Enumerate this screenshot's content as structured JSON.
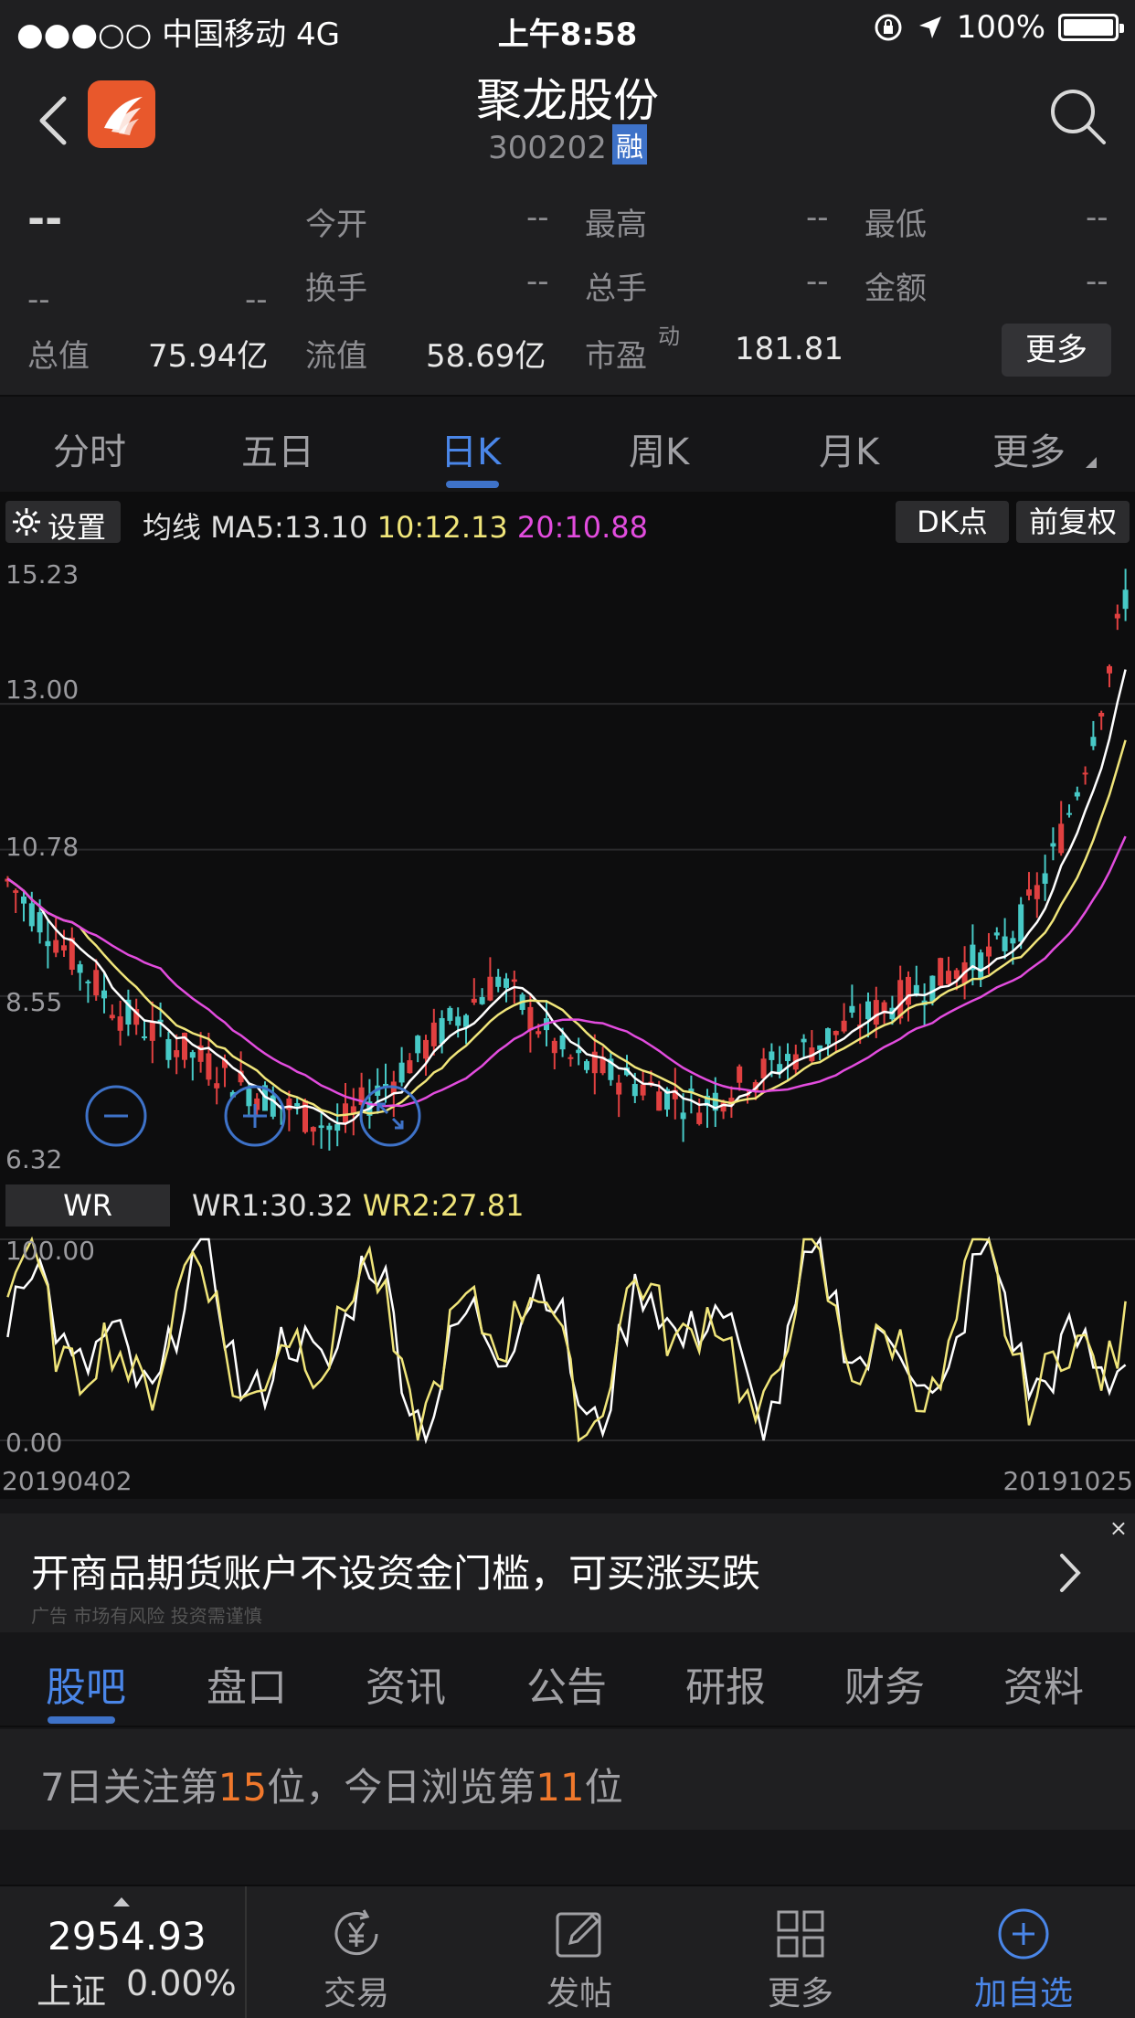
{
  "status_bar": {
    "carrier": "●●●○○ 中国移动   4G",
    "time": "上午8:58",
    "battery": "100%"
  },
  "header": {
    "stock_name": "聚龙股份",
    "stock_code": "300202",
    "badge": "融"
  },
  "quote": {
    "price": "--",
    "change": "--",
    "change_pct": "--",
    "rows": [
      {
        "label": "今开",
        "value": "--"
      },
      {
        "label": "最高",
        "value": "--"
      },
      {
        "label": "最低",
        "value": "--"
      },
      {
        "label": "换手",
        "value": "--"
      },
      {
        "label": "总手",
        "value": "--"
      },
      {
        "label": "金额",
        "value": "--"
      }
    ],
    "total_cap_label": "总值",
    "total_cap": "75.94亿",
    "float_cap_label": "流值",
    "float_cap": "58.69亿",
    "pe_label": "市盈",
    "pe_sup": "动",
    "pe": "181.81",
    "more_button": "更多"
  },
  "period_tabs": [
    "分时",
    "五日",
    "日K",
    "周K",
    "月K",
    "更多"
  ],
  "active_period": "日K",
  "chart_toolbar": {
    "settings": "设置",
    "ma_label": "均线",
    "ma5": "MA5:13.10",
    "ma10": "10:12.13",
    "ma20": "20:10.88",
    "dk_button": "DK点",
    "fq_button": "前复权"
  },
  "price_axis": [
    "15.23",
    "13.00",
    "10.78",
    "8.55",
    "6.32"
  ],
  "wr_toolbar": {
    "button": "WR",
    "wr1": "WR1:30.32",
    "wr2": "WR2:27.81"
  },
  "wr_axis": [
    "100.00",
    "0.00"
  ],
  "date_axis": {
    "start": "20190402",
    "end": "20191025"
  },
  "colors": {
    "up": "#e04040",
    "down": "#47c9c6",
    "ma5": "#ffffff",
    "ma10": "#f0e57a",
    "ma20": "#e24cde",
    "wr1": "#ffffff",
    "wr2": "#f0e57a",
    "accent": "#4a86e8",
    "highlight": "#f0782c"
  },
  "ad": {
    "text": "开商品期货账户不设资金门槛，可买涨买跌",
    "sub": "广告 市场有风险 投资需谨慎",
    "close": "×"
  },
  "info_tabs": [
    "股吧",
    "盘口",
    "资讯",
    "公告",
    "研报",
    "财务",
    "资料"
  ],
  "active_info_tab": "股吧",
  "rank": {
    "p1": "7日关注第",
    "n1": "15",
    "p2": "位，今日浏览第",
    "n2": "11",
    "p3": "位"
  },
  "bottom": {
    "index_value": "2954.93",
    "index_name": "上证",
    "index_change": "0.00%",
    "nav": [
      {
        "label": "交易",
        "icon": "yen-refresh-icon"
      },
      {
        "label": "发帖",
        "icon": "edit-icon"
      },
      {
        "label": "更多",
        "icon": "grid-icon"
      },
      {
        "label": "加自选",
        "icon": "add-circle-icon"
      }
    ]
  }
}
